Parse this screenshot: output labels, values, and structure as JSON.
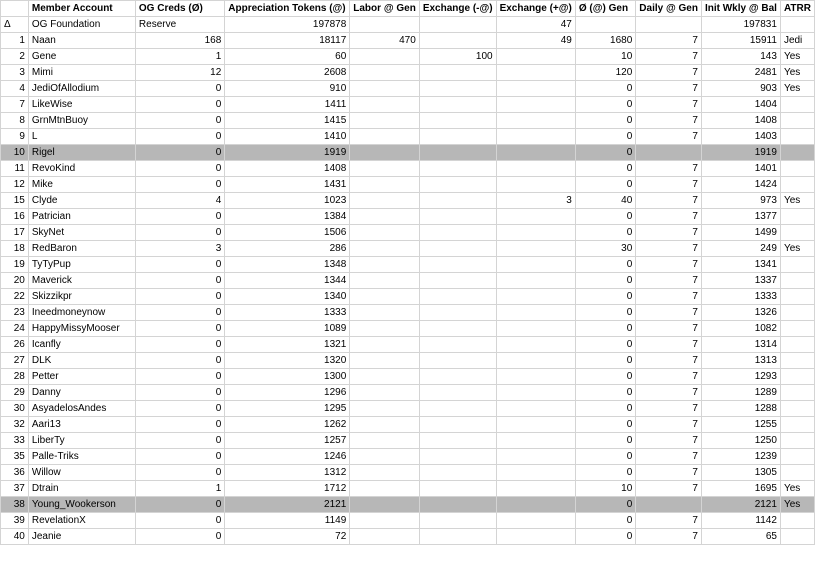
{
  "headers": [
    "",
    "Member Account",
    "OG Creds (Ø)",
    "Appreciation Tokens (@)",
    "Labor @ Gen",
    "Exchange (-@)",
    "Exchange (+@)",
    "Ø (@) Gen",
    "Daily @ Gen",
    "Init Wkly @ Bal",
    "ATRR"
  ],
  "colors": {
    "highlight_row": "#b7b7b7",
    "grid": "#d4d4d4"
  },
  "rows": [
    {
      "idx": "Δ",
      "name": "OG Foundation",
      "og": "Reserve",
      "tokens": "197878",
      "labor": "",
      "exm": "",
      "exp": "47",
      "gen": "",
      "daily": "",
      "init": "197831",
      "atrr": "",
      "hl": false
    },
    {
      "idx": "1",
      "name": "Naan",
      "og": "168",
      "tokens": "18117",
      "labor": "470",
      "exm": "",
      "exp": "49",
      "gen": "1680",
      "daily": "7",
      "init": "15911",
      "atrr": "Jedi",
      "hl": false
    },
    {
      "idx": "2",
      "name": "Gene",
      "og": "1",
      "tokens": "60",
      "labor": "",
      "exm": "100",
      "exp": "",
      "gen": "10",
      "daily": "7",
      "init": "143",
      "atrr": "Yes",
      "hl": false
    },
    {
      "idx": "3",
      "name": "Mimi",
      "og": "12",
      "tokens": "2608",
      "labor": "",
      "exm": "",
      "exp": "",
      "gen": "120",
      "daily": "7",
      "init": "2481",
      "atrr": "Yes",
      "hl": false
    },
    {
      "idx": "4",
      "name": "JediOfAllodium",
      "og": "0",
      "tokens": "910",
      "labor": "",
      "exm": "",
      "exp": "",
      "gen": "0",
      "daily": "7",
      "init": "903",
      "atrr": "Yes",
      "hl": false
    },
    {
      "idx": "7",
      "name": "LikeWise",
      "og": "0",
      "tokens": "1411",
      "labor": "",
      "exm": "",
      "exp": "",
      "gen": "0",
      "daily": "7",
      "init": "1404",
      "atrr": "",
      "hl": false
    },
    {
      "idx": "8",
      "name": "GrnMtnBuoy",
      "og": "0",
      "tokens": "1415",
      "labor": "",
      "exm": "",
      "exp": "",
      "gen": "0",
      "daily": "7",
      "init": "1408",
      "atrr": "",
      "hl": false
    },
    {
      "idx": "9",
      "name": "L",
      "og": "0",
      "tokens": "1410",
      "labor": "",
      "exm": "",
      "exp": "",
      "gen": "0",
      "daily": "7",
      "init": "1403",
      "atrr": "",
      "hl": false
    },
    {
      "idx": "10",
      "name": "Rigel",
      "og": "0",
      "tokens": "1919",
      "labor": "",
      "exm": "",
      "exp": "",
      "gen": "0",
      "daily": "",
      "init": "1919",
      "atrr": "",
      "hl": true
    },
    {
      "idx": "11",
      "name": "RevoKind",
      "og": "0",
      "tokens": "1408",
      "labor": "",
      "exm": "",
      "exp": "",
      "gen": "0",
      "daily": "7",
      "init": "1401",
      "atrr": "",
      "hl": false
    },
    {
      "idx": "12",
      "name": "Mike",
      "og": "0",
      "tokens": "1431",
      "labor": "",
      "exm": "",
      "exp": "",
      "gen": "0",
      "daily": "7",
      "init": "1424",
      "atrr": "",
      "hl": false
    },
    {
      "idx": "15",
      "name": "Clyde",
      "og": "4",
      "tokens": "1023",
      "labor": "",
      "exm": "",
      "exp": "3",
      "gen": "40",
      "daily": "7",
      "init": "973",
      "atrr": "Yes",
      "hl": false
    },
    {
      "idx": "16",
      "name": "Patrician",
      "og": "0",
      "tokens": "1384",
      "labor": "",
      "exm": "",
      "exp": "",
      "gen": "0",
      "daily": "7",
      "init": "1377",
      "atrr": "",
      "hl": false
    },
    {
      "idx": "17",
      "name": "SkyNet",
      "og": "0",
      "tokens": "1506",
      "labor": "",
      "exm": "",
      "exp": "",
      "gen": "0",
      "daily": "7",
      "init": "1499",
      "atrr": "",
      "hl": false
    },
    {
      "idx": "18",
      "name": "RedBaron",
      "og": "3",
      "tokens": "286",
      "labor": "",
      "exm": "",
      "exp": "",
      "gen": "30",
      "daily": "7",
      "init": "249",
      "atrr": "Yes",
      "hl": false
    },
    {
      "idx": "19",
      "name": "TyTyPup",
      "og": "0",
      "tokens": "1348",
      "labor": "",
      "exm": "",
      "exp": "",
      "gen": "0",
      "daily": "7",
      "init": "1341",
      "atrr": "",
      "hl": false
    },
    {
      "idx": "20",
      "name": "Maverick",
      "og": "0",
      "tokens": "1344",
      "labor": "",
      "exm": "",
      "exp": "",
      "gen": "0",
      "daily": "7",
      "init": "1337",
      "atrr": "",
      "hl": false
    },
    {
      "idx": "22",
      "name": "Skizzikpr",
      "og": "0",
      "tokens": "1340",
      "labor": "",
      "exm": "",
      "exp": "",
      "gen": "0",
      "daily": "7",
      "init": "1333",
      "atrr": "",
      "hl": false
    },
    {
      "idx": "23",
      "name": "Ineedmoneynow",
      "og": "0",
      "tokens": "1333",
      "labor": "",
      "exm": "",
      "exp": "",
      "gen": "0",
      "daily": "7",
      "init": "1326",
      "atrr": "",
      "hl": false
    },
    {
      "idx": "24",
      "name": "HappyMissyMooser",
      "og": "0",
      "tokens": "1089",
      "labor": "",
      "exm": "",
      "exp": "",
      "gen": "0",
      "daily": "7",
      "init": "1082",
      "atrr": "",
      "hl": false
    },
    {
      "idx": "26",
      "name": "Icanfly",
      "og": "0",
      "tokens": "1321",
      "labor": "",
      "exm": "",
      "exp": "",
      "gen": "0",
      "daily": "7",
      "init": "1314",
      "atrr": "",
      "hl": false
    },
    {
      "idx": "27",
      "name": "DLK",
      "og": "0",
      "tokens": "1320",
      "labor": "",
      "exm": "",
      "exp": "",
      "gen": "0",
      "daily": "7",
      "init": "1313",
      "atrr": "",
      "hl": false
    },
    {
      "idx": "28",
      "name": "Petter",
      "og": "0",
      "tokens": "1300",
      "labor": "",
      "exm": "",
      "exp": "",
      "gen": "0",
      "daily": "7",
      "init": "1293",
      "atrr": "",
      "hl": false
    },
    {
      "idx": "29",
      "name": "Danny",
      "og": "0",
      "tokens": "1296",
      "labor": "",
      "exm": "",
      "exp": "",
      "gen": "0",
      "daily": "7",
      "init": "1289",
      "atrr": "",
      "hl": false
    },
    {
      "idx": "30",
      "name": "AsyadelosAndes",
      "og": "0",
      "tokens": "1295",
      "labor": "",
      "exm": "",
      "exp": "",
      "gen": "0",
      "daily": "7",
      "init": "1288",
      "atrr": "",
      "hl": false
    },
    {
      "idx": "32",
      "name": "Aari13",
      "og": "0",
      "tokens": "1262",
      "labor": "",
      "exm": "",
      "exp": "",
      "gen": "0",
      "daily": "7",
      "init": "1255",
      "atrr": "",
      "hl": false
    },
    {
      "idx": "33",
      "name": "LiberTy",
      "og": "0",
      "tokens": "1257",
      "labor": "",
      "exm": "",
      "exp": "",
      "gen": "0",
      "daily": "7",
      "init": "1250",
      "atrr": "",
      "hl": false
    },
    {
      "idx": "35",
      "name": "Palle-Triks",
      "og": "0",
      "tokens": "1246",
      "labor": "",
      "exm": "",
      "exp": "",
      "gen": "0",
      "daily": "7",
      "init": "1239",
      "atrr": "",
      "hl": false
    },
    {
      "idx": "36",
      "name": "Willow",
      "og": "0",
      "tokens": "1312",
      "labor": "",
      "exm": "",
      "exp": "",
      "gen": "0",
      "daily": "7",
      "init": "1305",
      "atrr": "",
      "hl": false
    },
    {
      "idx": "37",
      "name": "Dtrain",
      "og": "1",
      "tokens": "1712",
      "labor": "",
      "exm": "",
      "exp": "",
      "gen": "10",
      "daily": "7",
      "init": "1695",
      "atrr": "Yes",
      "hl": false
    },
    {
      "idx": "38",
      "name": "Young_Wookerson",
      "og": "0",
      "tokens": "2121",
      "labor": "",
      "exm": "",
      "exp": "",
      "gen": "0",
      "daily": "",
      "init": "2121",
      "atrr": "Yes",
      "hl": true
    },
    {
      "idx": "39",
      "name": "RevelationX",
      "og": "0",
      "tokens": "1149",
      "labor": "",
      "exm": "",
      "exp": "",
      "gen": "0",
      "daily": "7",
      "init": "1142",
      "atrr": "",
      "hl": false
    },
    {
      "idx": "40",
      "name": "Jeanie",
      "og": "0",
      "tokens": "72",
      "labor": "",
      "exm": "",
      "exp": "",
      "gen": "0",
      "daily": "7",
      "init": "65",
      "atrr": "",
      "hl": false
    }
  ]
}
